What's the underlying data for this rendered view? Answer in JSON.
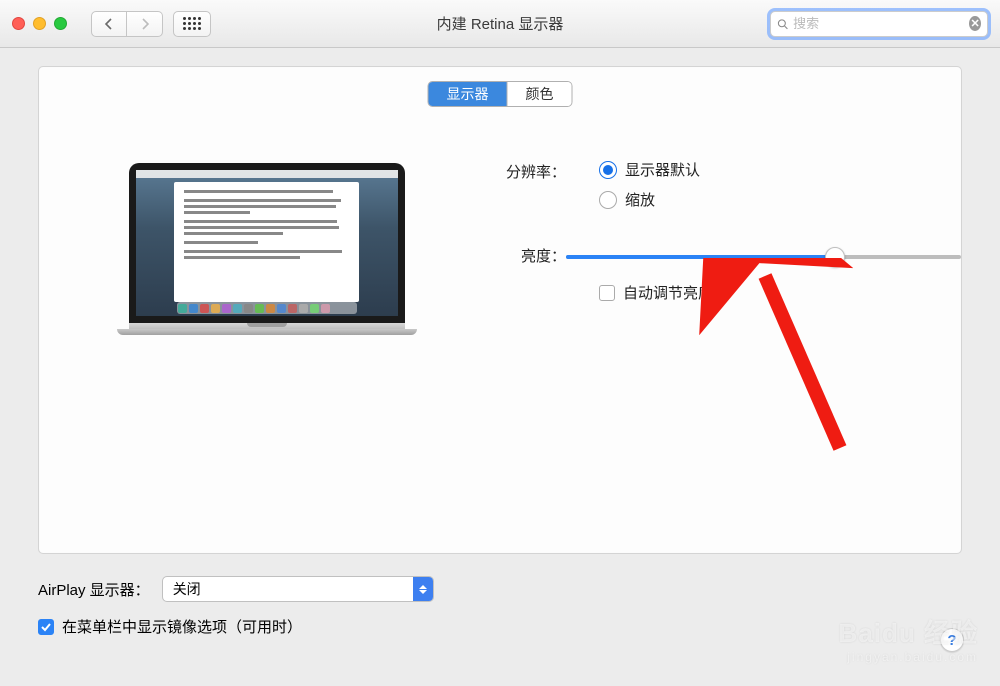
{
  "window": {
    "title": "内建 Retina 显示器"
  },
  "search": {
    "placeholder": "搜索"
  },
  "tabs": {
    "display": "显示器",
    "color": "颜色"
  },
  "resolution": {
    "label": "分辨率：",
    "default": "显示器默认",
    "scaled": "缩放"
  },
  "brightness": {
    "label": "亮度：",
    "auto": "自动调节亮度",
    "value_percent": 68
  },
  "airplay": {
    "label": "AirPlay 显示器：",
    "value": "关闭"
  },
  "mirror": {
    "label": "在菜单栏中显示镜像选项（可用时）"
  },
  "help": "?",
  "watermark": {
    "main": "Baidu 经验",
    "sub": "jingyan.baidu.com"
  }
}
